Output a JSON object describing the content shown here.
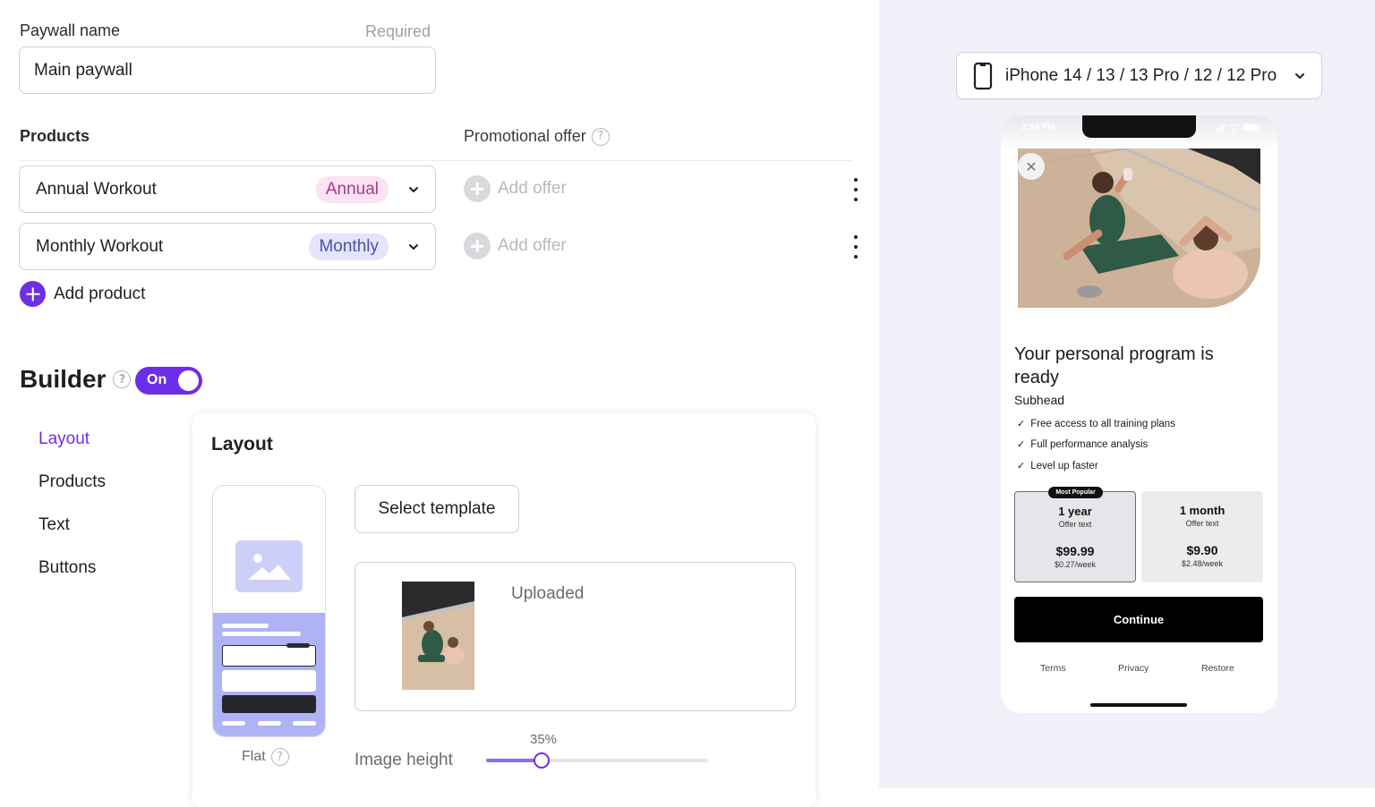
{
  "paywall": {
    "name_label": "Paywall name",
    "required_label": "Required",
    "name_value": "Main paywall"
  },
  "products_section": {
    "title": "Products",
    "promo_title": "Promotional offer",
    "items": [
      {
        "name": "Annual Workout",
        "tag": "Annual",
        "offer_label": "Add offer"
      },
      {
        "name": "Monthly Workout",
        "tag": "Monthly",
        "offer_label": "Add offer"
      }
    ],
    "add_product_label": "Add product"
  },
  "builder": {
    "title": "Builder",
    "toggle_label": "On",
    "nav": [
      "Layout",
      "Products",
      "Text",
      "Buttons"
    ],
    "active_nav": "Layout"
  },
  "layout_panel": {
    "title": "Layout",
    "layout_option_label": "Flat",
    "select_template_label": "Select template",
    "upload_status": "Uploaded",
    "image_height_label": "Image height",
    "image_height_value": "35%",
    "image_height_fraction": 0.25
  },
  "preview": {
    "device_label": "iPhone 14 / 13 / 13 Pro / 12 / 12 Pro",
    "status_time": "3:59 PM",
    "close_glyph": "✕",
    "title": "Your personal program is ready",
    "subhead": "Subhead",
    "features": [
      "Free access to all training plans",
      "Full performance analysis",
      "Level up faster"
    ],
    "check_glyph": "✓",
    "plans": [
      {
        "badge": "Most Popular",
        "name": "1 year",
        "offer": "Offer text",
        "price": "$99.99",
        "per_week": "$0.27/week"
      },
      {
        "badge": "",
        "name": "1 month",
        "offer": "Offer text",
        "price": "$9.90",
        "per_week": "$2.48/week"
      }
    ],
    "continue_label": "Continue",
    "links": [
      "Terms",
      "Privacy",
      "Restore"
    ]
  },
  "colors": {
    "accent": "#6d2ee8",
    "annual_pill_bg": "#fbe3f4",
    "monthly_pill_bg": "#e4e5fb",
    "preview_bg": "#f0f0f9"
  },
  "icons": {
    "help": "question-circle-icon",
    "chevron": "chevron-down-icon",
    "add": "plus-circle-icon",
    "more": "kebab-menu-icon",
    "device": "phone-outline-icon",
    "close": "close-icon",
    "check": "check-icon"
  }
}
